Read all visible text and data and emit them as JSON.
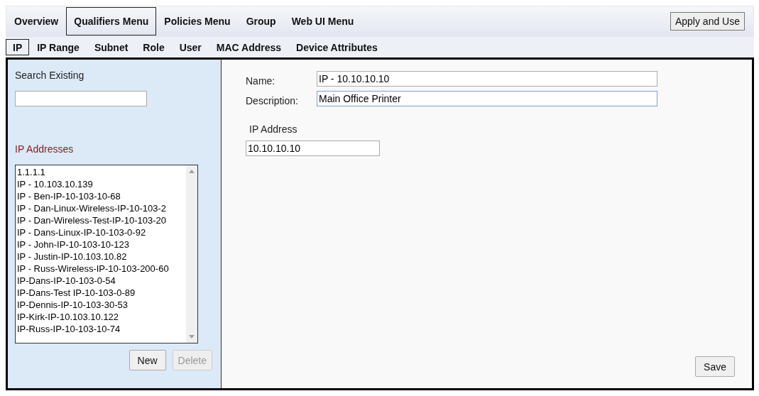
{
  "menu": [
    {
      "label": "Overview",
      "selected": false
    },
    {
      "label": "Qualifiers Menu",
      "selected": true
    },
    {
      "label": "Policies Menu",
      "selected": false
    },
    {
      "label": "Group",
      "selected": false
    },
    {
      "label": "Web UI Menu",
      "selected": false
    }
  ],
  "apply_button": "Apply and Use",
  "subtabs": [
    {
      "label": "IP",
      "selected": true
    },
    {
      "label": "IP Range",
      "selected": false
    },
    {
      "label": "Subnet",
      "selected": false
    },
    {
      "label": "Role",
      "selected": false
    },
    {
      "label": "User",
      "selected": false
    },
    {
      "label": "MAC Address",
      "selected": false
    },
    {
      "label": "Device Attributes",
      "selected": false
    }
  ],
  "sidebar": {
    "search_label": "Search Existing",
    "list_label": "IP Addresses",
    "items": [
      "1.1.1.1",
      "IP - 10.103.10.139",
      "IP - Ben-IP-10-103-10-68",
      "IP - Dan-Linux-Wireless-IP-10-103-2",
      "IP - Dan-Wireless-Test-IP-10-103-20",
      "IP - Dans-Linux-IP-10-103-0-92",
      "IP - John-IP-10-103-10-123",
      "IP - Justin-IP-10.103.10.82",
      "IP - Russ-Wireless-IP-10-103-200-60",
      "IP-Dans-IP-10-103-0-54",
      "IP-Dans-Test IP-10-103-0-89",
      "IP-Dennis-IP-10-103-30-53",
      "IP-Kirk-IP-10.103.10.122",
      "IP-Russ-IP-10-103-10-74"
    ],
    "buttons": [
      {
        "label": "New",
        "disabled": false
      },
      {
        "label": "Delete",
        "disabled": true
      }
    ]
  },
  "form": {
    "fields": [
      {
        "label": "Name:",
        "value": "IP - 10.10.10.10",
        "focused": false
      },
      {
        "label": "Description:",
        "value": "Main Office Printer",
        "focused": true
      }
    ],
    "ip_label": "IP Address",
    "ip_value": "10.10.10.10",
    "save_button": "Save"
  }
}
